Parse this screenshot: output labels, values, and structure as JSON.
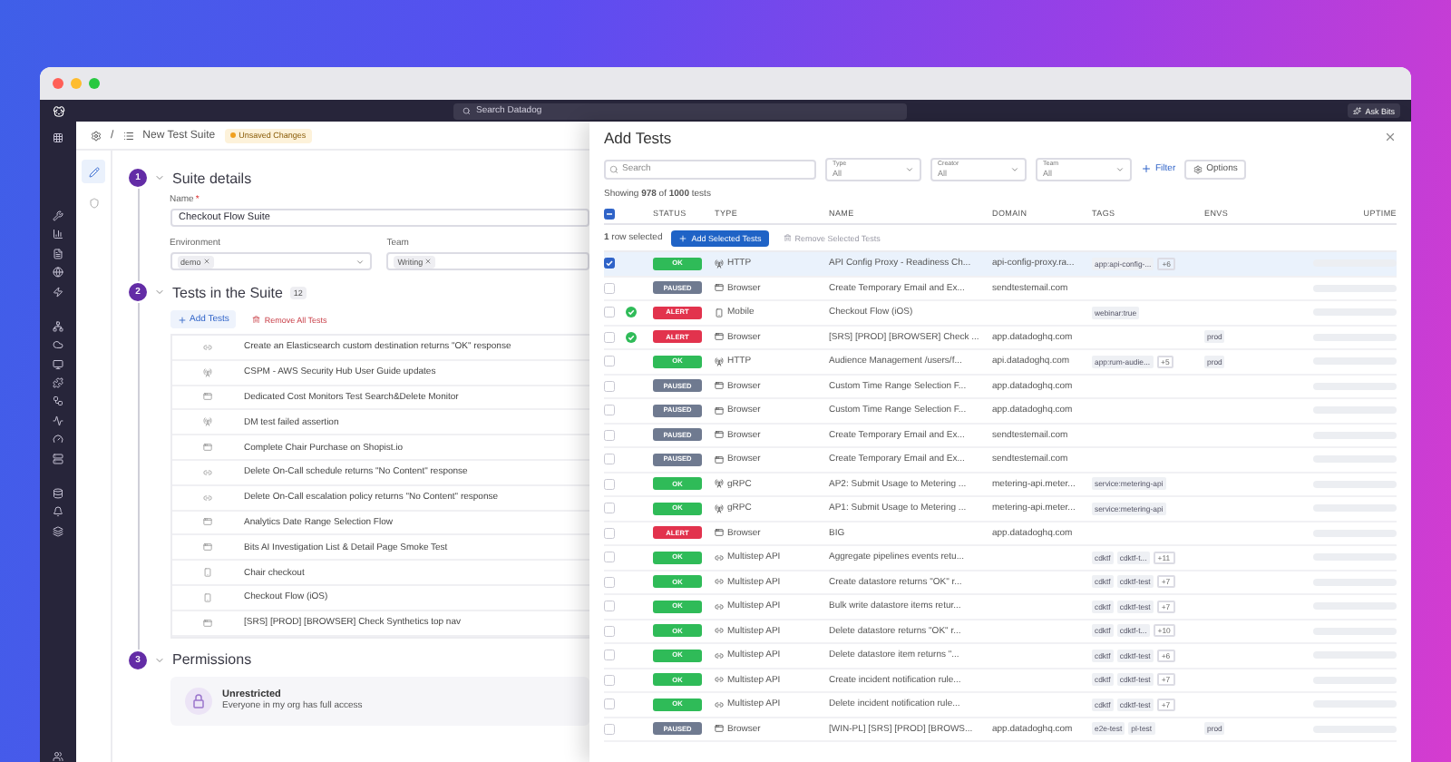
{
  "top_nav": {
    "search_placeholder": "Search Datadog",
    "ask_button": "Ask Bits"
  },
  "breadcrumb": {
    "separator": "/",
    "title": "New Test Suite",
    "badge": "Unsaved Changes"
  },
  "side_tabs": [
    {
      "kind": "edit",
      "selected": true
    },
    {
      "kind": "shield",
      "selected": false
    }
  ],
  "suite_details": {
    "number": "1",
    "title": "Suite details",
    "name_label": "Name",
    "required_mark": "*",
    "name_value": "Checkout Flow Suite",
    "environment_label": "Environment",
    "environment_chips": [
      "demo"
    ],
    "team_label": "Team",
    "team_chips": [
      "Writing"
    ]
  },
  "tests_section": {
    "number": "2",
    "title": "Tests in the Suite",
    "count": "12",
    "add_button": "Add Tests",
    "remove_button": "Remove All Tests",
    "items": [
      {
        "kind": "multistep",
        "name": "Create an Elasticsearch custom destination returns \"OK\" response"
      },
      {
        "kind": "http",
        "name": "CSPM - AWS Security Hub User Guide updates"
      },
      {
        "kind": "browser",
        "name": "Dedicated Cost Monitors Test Search&Delete Monitor"
      },
      {
        "kind": "http",
        "name": "DM test failed assertion"
      },
      {
        "kind": "browser",
        "name": "Complete Chair Purchase on Shopist.io"
      },
      {
        "kind": "multistep",
        "name": "Delete On-Call schedule returns \"No Content\" response"
      },
      {
        "kind": "multistep",
        "name": "Delete On-Call escalation policy returns \"No Content\" response"
      },
      {
        "kind": "browser",
        "name": "Analytics Date Range Selection Flow"
      },
      {
        "kind": "browser",
        "name": "Bits AI Investigation List & Detail Page Smoke Test"
      },
      {
        "kind": "mobile",
        "name": "Chair checkout"
      },
      {
        "kind": "mobile",
        "name": "Checkout Flow (iOS)"
      },
      {
        "kind": "browser",
        "name": "[SRS] [PROD] [BROWSER] Check Synthetics top nav"
      }
    ]
  },
  "permissions": {
    "number": "3",
    "title": "Permissions",
    "card_title": "Unrestricted",
    "card_text": "Everyone in my org has full access"
  },
  "drawer": {
    "title": "Add Tests",
    "search_placeholder": "Search",
    "selects": [
      {
        "label": "Type",
        "value": "All"
      },
      {
        "label": "Creator",
        "value": "All"
      },
      {
        "label": "Team",
        "value": "All"
      }
    ],
    "filter_link": "Filter",
    "options_button": "Options",
    "showing": "Showing **978** of **1000** tests",
    "table": {
      "select_all": {
        "kind": "partial"
      },
      "columns": [
        "STATUS",
        "TYPE",
        "NAME",
        "DOMAIN",
        "TAGS",
        "ENVS",
        "UPTIME"
      ],
      "selection": {
        "text": "**1** row selected",
        "add_button": "Add Selected Tests",
        "remove_button": "Remove Selected Tests",
        "remove_disabled": true
      },
      "rows": [
        {
          "selected": true,
          "passed": false,
          "status": {
            "label": "OK",
            "kind": "ok"
          },
          "type": {
            "label": "HTTP",
            "kind": "http"
          },
          "name": "API Config Proxy - Readiness Ch...",
          "domain": "api-config-proxy.ra...",
          "tags": [
            "app:api-config-..."
          ],
          "more": "+6",
          "envs": []
        },
        {
          "selected": false,
          "passed": false,
          "status": {
            "label": "PAUSED",
            "kind": "paused"
          },
          "type": {
            "label": "Browser",
            "kind": "browser"
          },
          "name": "Create Temporary Email and Ex...",
          "domain": "sendtestemail.com",
          "tags": [],
          "envs": []
        },
        {
          "selected": false,
          "passed": true,
          "status": {
            "label": "ALERT",
            "kind": "alert"
          },
          "type": {
            "label": "Mobile",
            "kind": "mobile"
          },
          "name": "Checkout Flow (iOS)",
          "tags": [
            "webinar:true"
          ],
          "envs": []
        },
        {
          "selected": false,
          "passed": true,
          "status": {
            "label": "ALERT",
            "kind": "alert"
          },
          "type": {
            "label": "Browser",
            "kind": "browser"
          },
          "name": "[SRS] [PROD] [BROWSER] Check ...",
          "domain": "app.datadoghq.com",
          "tags": [],
          "envs": [
            "prod"
          ]
        },
        {
          "selected": false,
          "passed": false,
          "status": {
            "label": "OK",
            "kind": "ok"
          },
          "type": {
            "label": "HTTP",
            "kind": "http"
          },
          "name": "Audience Management /users/f...",
          "domain": "api.datadoghq.com",
          "tags": [
            "app:rum-audie..."
          ],
          "more": "+5",
          "envs": [
            "prod"
          ]
        },
        {
          "selected": false,
          "passed": false,
          "status": {
            "label": "PAUSED",
            "kind": "paused"
          },
          "type": {
            "label": "Browser",
            "kind": "browser"
          },
          "name": "Custom Time Range Selection F...",
          "domain": "app.datadoghq.com",
          "tags": [],
          "envs": []
        },
        {
          "selected": false,
          "passed": false,
          "status": {
            "label": "PAUSED",
            "kind": "paused"
          },
          "type": {
            "label": "Browser",
            "kind": "browser"
          },
          "name": "Custom Time Range Selection F...",
          "domain": "app.datadoghq.com",
          "tags": [],
          "envs": []
        },
        {
          "selected": false,
          "passed": false,
          "status": {
            "label": "PAUSED",
            "kind": "paused"
          },
          "type": {
            "label": "Browser",
            "kind": "browser"
          },
          "name": "Create Temporary Email and Ex...",
          "domain": "sendtestemail.com",
          "tags": [],
          "envs": []
        },
        {
          "selected": false,
          "passed": false,
          "status": {
            "label": "PAUSED",
            "kind": "paused"
          },
          "type": {
            "label": "Browser",
            "kind": "browser"
          },
          "name": "Create Temporary Email and Ex...",
          "domain": "sendtestemail.com",
          "tags": [],
          "envs": []
        },
        {
          "selected": false,
          "passed": false,
          "status": {
            "label": "OK",
            "kind": "ok"
          },
          "type": {
            "label": "gRPC",
            "kind": "http"
          },
          "name": "AP2: Submit Usage to Metering ...",
          "domain": "metering-api.meter...",
          "tags": [
            "service:metering-api"
          ],
          "envs": []
        },
        {
          "selected": false,
          "passed": false,
          "status": {
            "label": "OK",
            "kind": "ok"
          },
          "type": {
            "label": "gRPC",
            "kind": "http"
          },
          "name": "AP1: Submit Usage to Metering ...",
          "domain": "metering-api.meter...",
          "tags": [
            "service:metering-api"
          ],
          "envs": []
        },
        {
          "selected": false,
          "passed": false,
          "status": {
            "label": "ALERT",
            "kind": "alert"
          },
          "type": {
            "label": "Browser",
            "kind": "browser"
          },
          "name": "BIG",
          "domain": "app.datadoghq.com",
          "tags": [],
          "envs": []
        },
        {
          "selected": false,
          "passed": false,
          "status": {
            "label": "OK",
            "kind": "ok"
          },
          "type": {
            "label": "Multistep API",
            "kind": "multistep"
          },
          "name": "Aggregate pipelines events retu...",
          "tags": [
            "cdktf",
            "cdktf-t..."
          ],
          "more": "+11",
          "envs": []
        },
        {
          "selected": false,
          "passed": false,
          "status": {
            "label": "OK",
            "kind": "ok"
          },
          "type": {
            "label": "Multistep API",
            "kind": "multistep"
          },
          "name": "Create datastore returns \"OK\" r...",
          "tags": [
            "cdktf",
            "cdktf-test"
          ],
          "more": "+7",
          "envs": []
        },
        {
          "selected": false,
          "passed": false,
          "status": {
            "label": "OK",
            "kind": "ok"
          },
          "type": {
            "label": "Multistep API",
            "kind": "multistep"
          },
          "name": "Bulk write datastore items retur...",
          "tags": [
            "cdktf",
            "cdktf-test"
          ],
          "more": "+7",
          "envs": []
        },
        {
          "selected": false,
          "passed": false,
          "status": {
            "label": "OK",
            "kind": "ok"
          },
          "type": {
            "label": "Multistep API",
            "kind": "multistep"
          },
          "name": "Delete datastore returns \"OK\" r...",
          "tags": [
            "cdktf",
            "cdktf-t..."
          ],
          "more": "+10",
          "envs": []
        },
        {
          "selected": false,
          "passed": false,
          "status": {
            "label": "OK",
            "kind": "ok"
          },
          "type": {
            "label": "Multistep API",
            "kind": "multistep"
          },
          "name": "Delete datastore item returns \"...",
          "tags": [
            "cdktf",
            "cdktf-test"
          ],
          "more": "+6",
          "envs": []
        },
        {
          "selected": false,
          "passed": false,
          "status": {
            "label": "OK",
            "kind": "ok"
          },
          "type": {
            "label": "Multistep API",
            "kind": "multistep"
          },
          "name": "Create incident notification rule...",
          "tags": [
            "cdktf",
            "cdktf-test"
          ],
          "more": "+7",
          "envs": []
        },
        {
          "selected": false,
          "passed": false,
          "status": {
            "label": "OK",
            "kind": "ok"
          },
          "type": {
            "label": "Multistep API",
            "kind": "multistep"
          },
          "name": "Delete incident notification rule...",
          "tags": [
            "cdktf",
            "cdktf-test"
          ],
          "more": "+7",
          "envs": []
        },
        {
          "selected": false,
          "passed": false,
          "status": {
            "label": "PAUSED",
            "kind": "paused"
          },
          "type": {
            "label": "Browser",
            "kind": "browser"
          },
          "name": "[WIN-PL] [SRS] [PROD] [BROWS...",
          "domain": "app.datadoghq.com",
          "tags": [
            "e2e-test",
            "pl-test"
          ],
          "envs": [
            "prod"
          ]
        }
      ]
    }
  }
}
